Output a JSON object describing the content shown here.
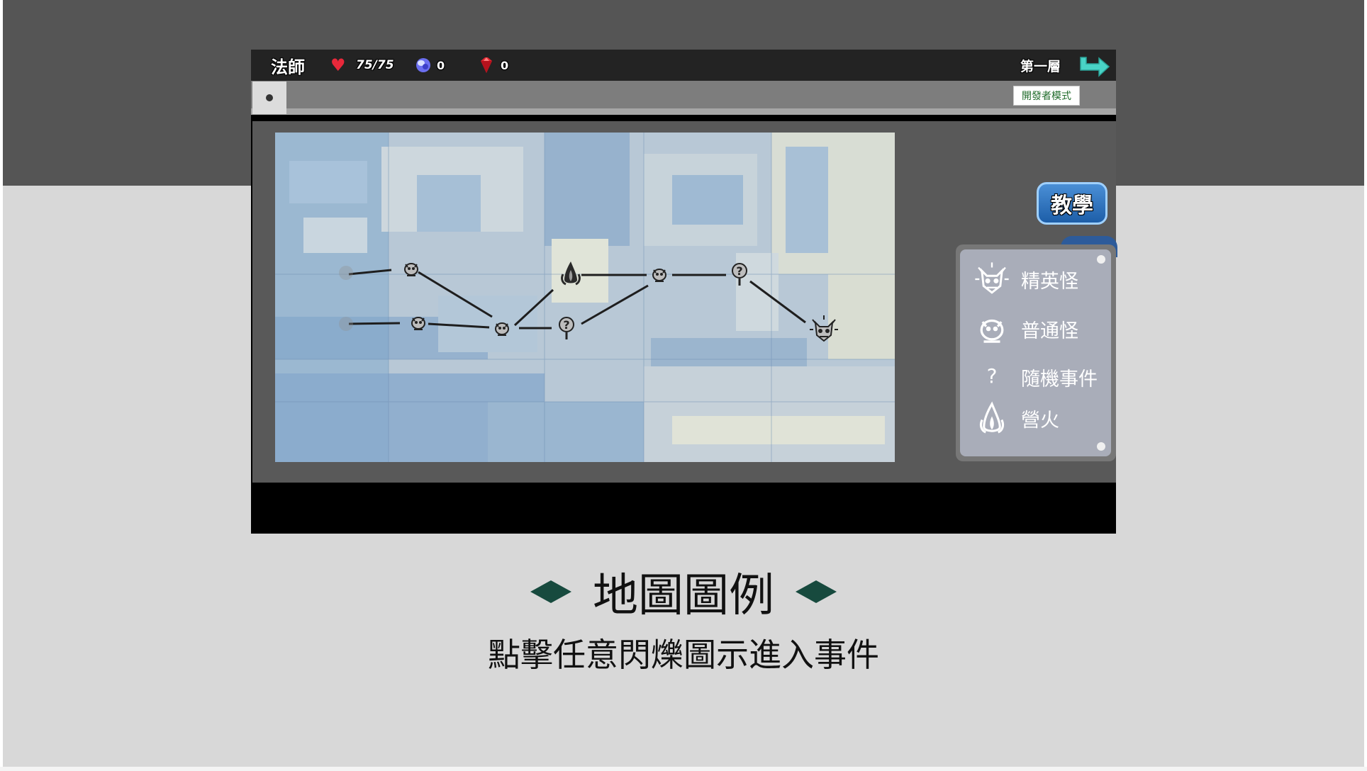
{
  "hud": {
    "class_name": "法師",
    "hp": "75/75",
    "orbs": "0",
    "gems": "0",
    "floor": "第一層"
  },
  "toolbar": {
    "dev_mode_label": "開發者模式"
  },
  "tutorial": {
    "label": "教學"
  },
  "legend": {
    "items": [
      {
        "icon": "elite-monster-icon",
        "label": "精英怪"
      },
      {
        "icon": "normal-monster-icon",
        "label": "普通怪"
      },
      {
        "icon": "random-event-icon",
        "label": "隨機事件"
      },
      {
        "icon": "campfire-icon",
        "label": "營火"
      }
    ]
  },
  "caption": {
    "title": "地圖圖例",
    "subtitle": "點擊任意閃爍圖示進入事件"
  },
  "colors": {
    "hud_bg": "#232323",
    "hp_heart": "#e8283a",
    "tutorial_button": "#1d5ea8",
    "diamond": "#174a3e",
    "next_arrow": "#49d3c6"
  }
}
